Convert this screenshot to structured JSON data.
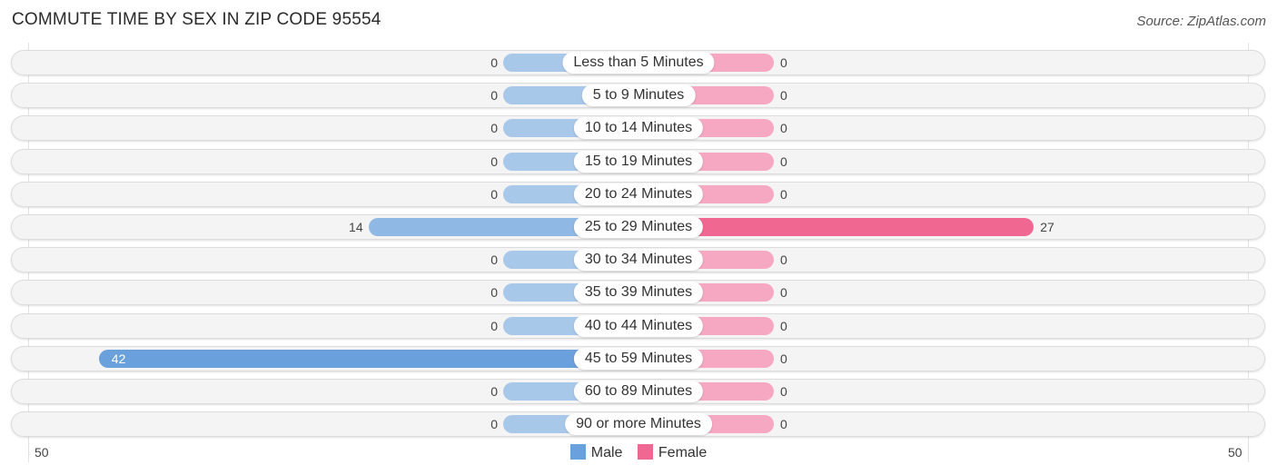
{
  "title": "COMMUTE TIME BY SEX IN ZIP CODE 95554",
  "source": "Source: ZipAtlas.com",
  "colors": {
    "male": "#6aa0dc",
    "female": "#f06892",
    "male_light": "#a8c8ea",
    "female_light": "#f6a8c2"
  },
  "chart_data": {
    "type": "bar",
    "orientation": "horizontal-diverging",
    "title": "COMMUTE TIME BY SEX IN ZIP CODE 95554",
    "categories": [
      "Less than 5 Minutes",
      "5 to 9 Minutes",
      "10 to 14 Minutes",
      "15 to 19 Minutes",
      "20 to 24 Minutes",
      "25 to 29 Minutes",
      "30 to 34 Minutes",
      "35 to 39 Minutes",
      "40 to 44 Minutes",
      "45 to 59 Minutes",
      "60 to 89 Minutes",
      "90 or more Minutes"
    ],
    "series": [
      {
        "name": "Male",
        "values": [
          0,
          0,
          0,
          0,
          0,
          14,
          0,
          0,
          0,
          42,
          0,
          0
        ]
      },
      {
        "name": "Female",
        "values": [
          0,
          0,
          0,
          0,
          0,
          27,
          0,
          0,
          0,
          0,
          0,
          0
        ]
      }
    ],
    "xlim": [
      50,
      50
    ],
    "axis_labels": {
      "left": "50",
      "right": "50"
    },
    "legend": {
      "position": "bottom-center",
      "entries": [
        "Male",
        "Female"
      ]
    }
  }
}
